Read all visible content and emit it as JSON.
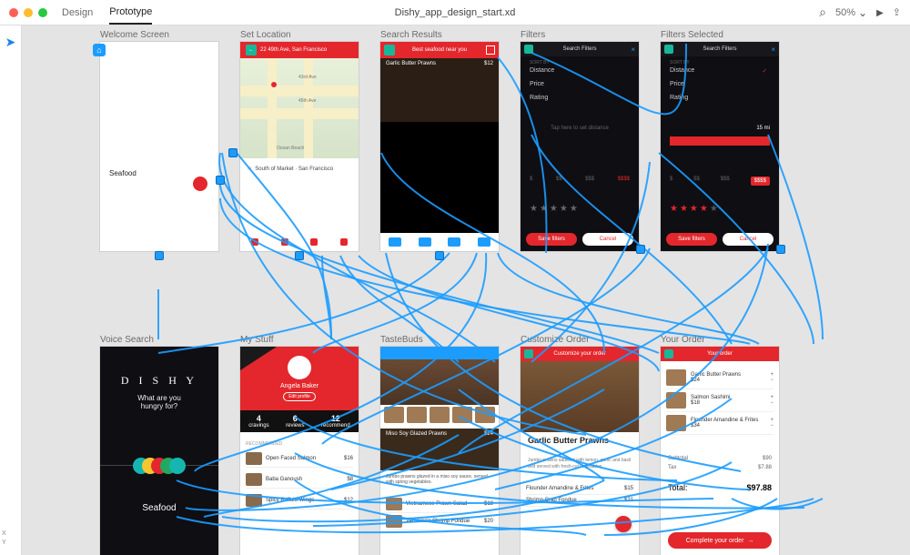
{
  "topbar": {
    "tabs": {
      "design": "Design",
      "prototype": "Prototype"
    },
    "doc_title": "Dishy_app_design_start.xd",
    "zoom": "50%"
  },
  "corner": {
    "x": "X",
    "y": "Y"
  },
  "artboards": {
    "welcome": {
      "label": "Welcome Screen",
      "text": "Seafood"
    },
    "location": {
      "label": "Set Location",
      "address": "22 49th Ave, San Francisco",
      "beach_label": "Ocean Beach",
      "street_43": "43rd Ave",
      "street_45": "45th Ave",
      "loc_row": "South of Market · San Francisco"
    },
    "results": {
      "label": "Search Results",
      "header": "Best seafood near you",
      "card_title": "Garlic Butter Prawns",
      "card_price": "$12"
    },
    "filters": {
      "label": "Filters",
      "header": "Search Filters",
      "sublabel": "SORT BY",
      "opts": {
        "distance": "Distance",
        "price": "Price",
        "rating": "Rating"
      },
      "slider_hint": "Tap here to set distance",
      "price_row": {
        "p1": "$",
        "p2": "$$",
        "p3": "$$$",
        "p4": "$$$$"
      },
      "save": "Save filters",
      "cancel": "Cancel"
    },
    "filters_sel": {
      "label": "Filters Selected",
      "header": "Search Filters",
      "sublabel": "SORT BY",
      "slider_val": "15 mi",
      "save": "Save filters",
      "cancel": "Cancel"
    },
    "voice": {
      "label": "Voice Search",
      "brand": "D I S H Y",
      "prompt_l1": "What are you",
      "prompt_l2": "hungry for?",
      "result": "Seafood"
    },
    "profile": {
      "label": "My Stuff",
      "name": "Angela Baker",
      "edit": "Edit profile",
      "stats": {
        "n1": "4",
        "l1": "cravings",
        "n2": "6",
        "l2": "reviews",
        "n3": "12",
        "l3": "recommend"
      },
      "section": "RECOMMENDED",
      "items": {
        "i1": "Open Faced Salmon",
        "p1": "$16",
        "i2": "Baba Ganoush",
        "p2": "$8",
        "i3": "Spicy Buffalo Wings",
        "p3": "$12"
      }
    },
    "tastebuds": {
      "label": "TasteBuds",
      "card_title": "Miso Soy Glazed Prawns",
      "card_price": "$24",
      "desc": "Jumbo prawns glazed in a miso soy sauce, served with spring vegetables.",
      "item1": "Vietnamese Prawn Salad",
      "price1": "$18",
      "item2": "Veronica's Shrimp Fondue",
      "price2": "$20"
    },
    "customize": {
      "label": "Customize Order",
      "header": "Customize your order",
      "title": "Garlic Butter Prawns",
      "desc": "Jumbo prawns sautéed with lemon, garlic and basil and served with fresh-cut vegetables.",
      "row1": "Flounder Amandine & Frites",
      "row1p": "$15",
      "row2": "Shrimp Crab Fondue",
      "row2p": "$21"
    },
    "order": {
      "label": "Your Order",
      "header": "Your order",
      "items": {
        "n1": "Garlic Butter Prawns",
        "p1": "$24",
        "n2": "Salmon Sashimi",
        "p2": "$18",
        "n3": "Flounder Amandine & Frites",
        "p3": "$34"
      },
      "subtotal_l": "Subtotal",
      "subtotal_v": "$90",
      "tax_l": "Tax",
      "tax_v": "$7.88",
      "total_l": "Total:",
      "total_v": "$97.88",
      "cta": "Complete your order"
    }
  }
}
